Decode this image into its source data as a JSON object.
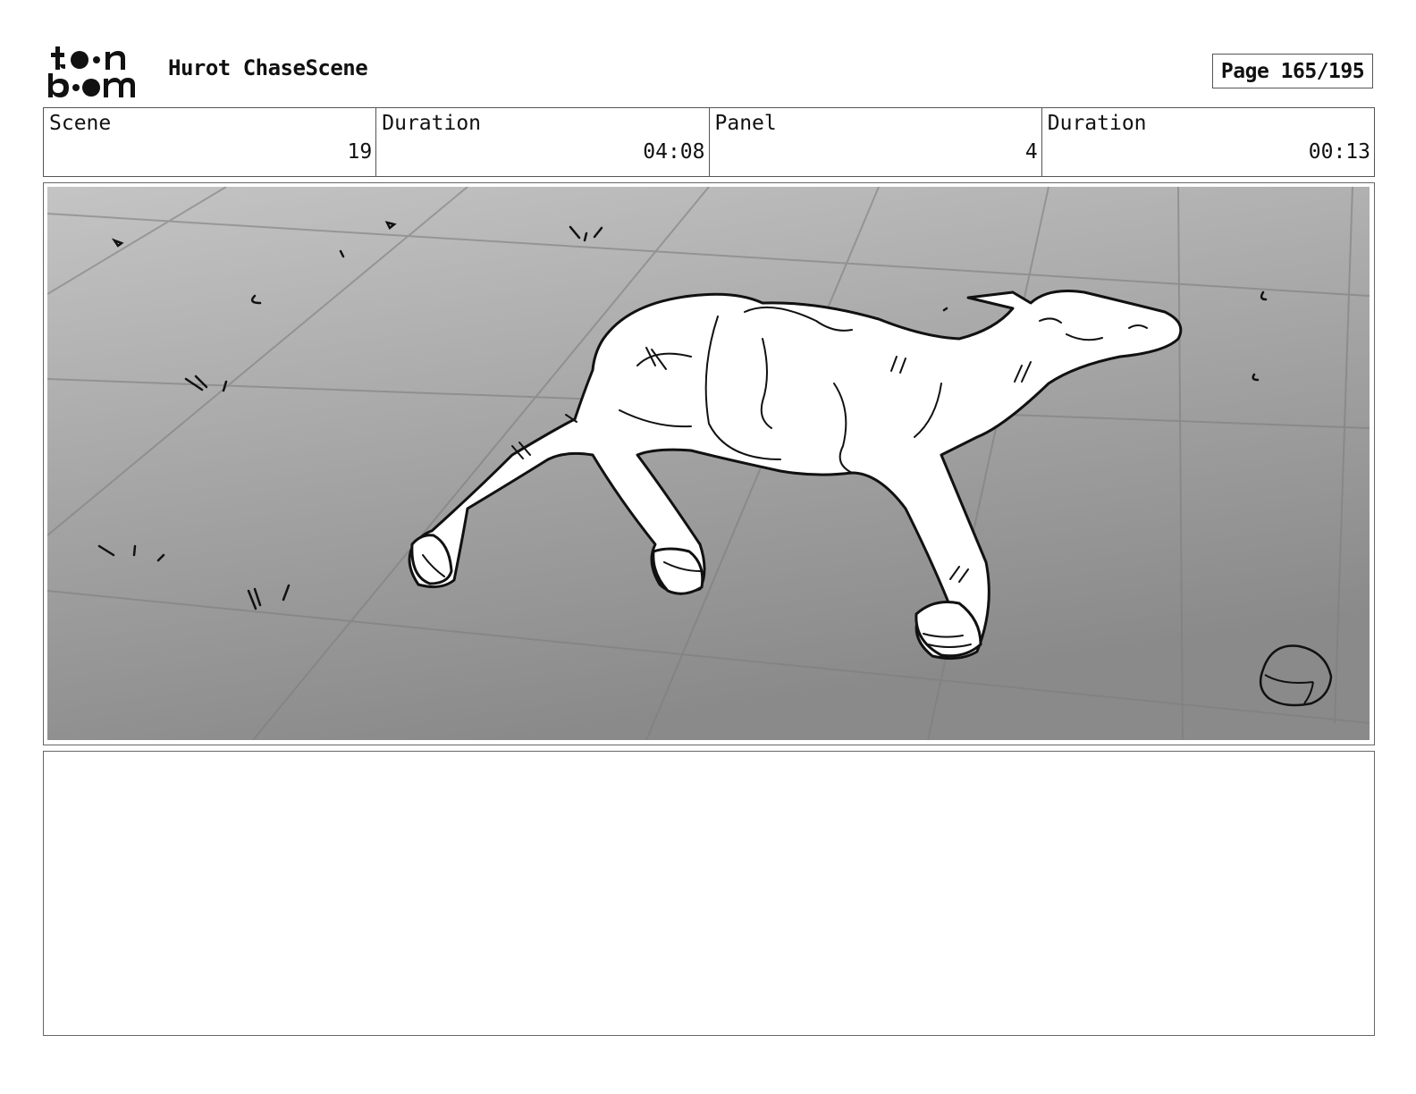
{
  "header": {
    "logo_text": "toon boom",
    "project_title": "Hurot ChaseScene",
    "page_label": "Page 165/195"
  },
  "info": {
    "scene_label": "Scene",
    "scene_value": "19",
    "scene_duration_label": "Duration",
    "scene_duration_value": "04:08",
    "panel_label": "Panel",
    "panel_value": "4",
    "panel_duration_label": "Duration",
    "panel_duration_value": "00:13"
  },
  "panel": {
    "image_icon": "deer-lying-on-ground-sketch"
  },
  "notes": {
    "text": ""
  }
}
